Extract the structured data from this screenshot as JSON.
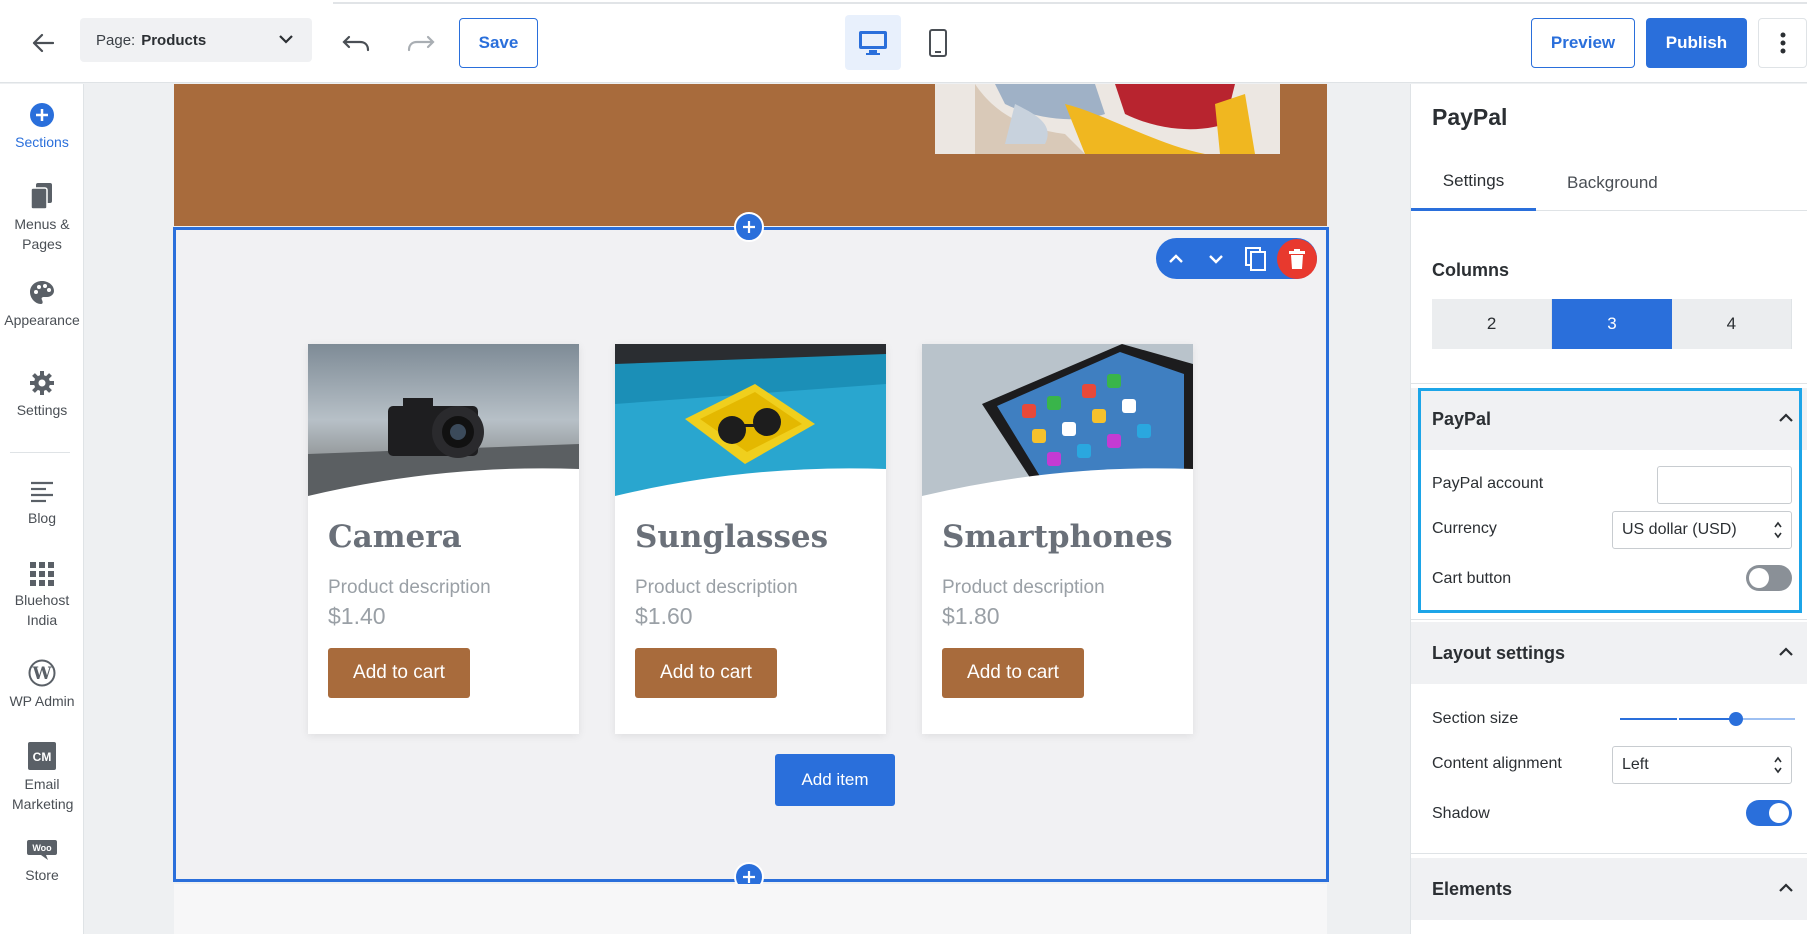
{
  "header": {
    "page_prefix": "Page:",
    "page_name": "Products",
    "save_label": "Save",
    "preview_label": "Preview",
    "publish_label": "Publish"
  },
  "sidebar": {
    "items": [
      {
        "label": "Sections",
        "icon": "plus-circle-icon"
      },
      {
        "label": "Menus & Pages",
        "icon": "pages-icon"
      },
      {
        "label": "Appearance",
        "icon": "palette-icon"
      },
      {
        "label": "Settings",
        "icon": "gear-icon"
      },
      {
        "label": "Blog",
        "icon": "blog-icon"
      },
      {
        "label": "Bluehost India",
        "icon": "grid-icon"
      },
      {
        "label": "WP Admin",
        "icon": "wordpress-icon"
      },
      {
        "label": "Email Marketing",
        "icon": "cm-icon"
      },
      {
        "label": "Store",
        "icon": "woo-icon"
      }
    ]
  },
  "canvas": {
    "products": [
      {
        "title": "Camera",
        "description": "Product description",
        "price": "$1.40",
        "button": "Add to cart"
      },
      {
        "title": "Sunglasses",
        "description": "Product description",
        "price": "$1.60",
        "button": "Add to cart"
      },
      {
        "title": "Smartphones",
        "description": "Product description",
        "price": "$1.80",
        "button": "Add to cart"
      }
    ],
    "add_item_label": "Add item"
  },
  "panel": {
    "title": "PayPal",
    "tabs": [
      "Settings",
      "Background"
    ],
    "columns_label": "Columns",
    "column_options": [
      "2",
      "3",
      "4"
    ],
    "columns_selected": "3",
    "paypal_section": {
      "heading": "PayPal",
      "account_label": "PayPal account",
      "account_value": "",
      "currency_label": "Currency",
      "currency_value": "US dollar (USD)",
      "cart_label": "Cart button",
      "cart_enabled": false
    },
    "layout_section": {
      "heading": "Layout settings",
      "size_label": "Section size",
      "size_value": 0.7,
      "alignment_label": "Content alignment",
      "alignment_value": "Left",
      "shadow_label": "Shadow",
      "shadow_enabled": true
    },
    "elements_heading": "Elements"
  },
  "colors": {
    "accent": "#2a6fdb",
    "brown": "#a86b3c",
    "highlight": "#1ca5e8",
    "delete": "#e8392e"
  }
}
